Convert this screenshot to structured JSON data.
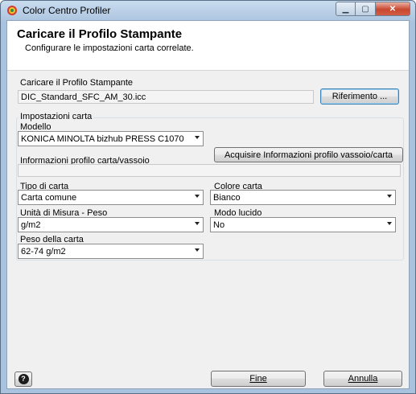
{
  "window": {
    "title": "Color Centro Profiler",
    "minimize_icon": "minimize-icon",
    "maximize_icon": "maximize-icon",
    "close_icon": "close-icon"
  },
  "header": {
    "title": "Caricare il Profilo Stampante",
    "subtitle": "Configurare le impostazioni carta correlate."
  },
  "profile": {
    "label": "Caricare il Profilo Stampante",
    "filename": "DIC_Standard_SFC_AM_30.icc",
    "browse_label": "Riferimento ..."
  },
  "paper_settings": {
    "group_title": "Impostazioni carta",
    "model_label": "Modello",
    "model_value": "KONICA MINOLTA bizhub PRESS C1070",
    "acquire_button": "Acquisire Informazioni profilo vassoio/carta",
    "tray_info_label": "Informazioni profilo carta/vassoio",
    "tray_info_value": "",
    "paper_type_label": "Tipo di carta",
    "paper_type_value": "Carta comune",
    "paper_color_label": "Colore carta",
    "paper_color_value": "Bianco",
    "unit_label": "Unità di Misura - Peso",
    "unit_value": "g/m2",
    "gloss_label": "Modo lucido",
    "gloss_value": "No",
    "weight_label": "Peso della carta",
    "weight_value": "62-74 g/m2"
  },
  "footer": {
    "help_label": "?",
    "finish_label": "Fine",
    "cancel_label": "Annulla"
  }
}
